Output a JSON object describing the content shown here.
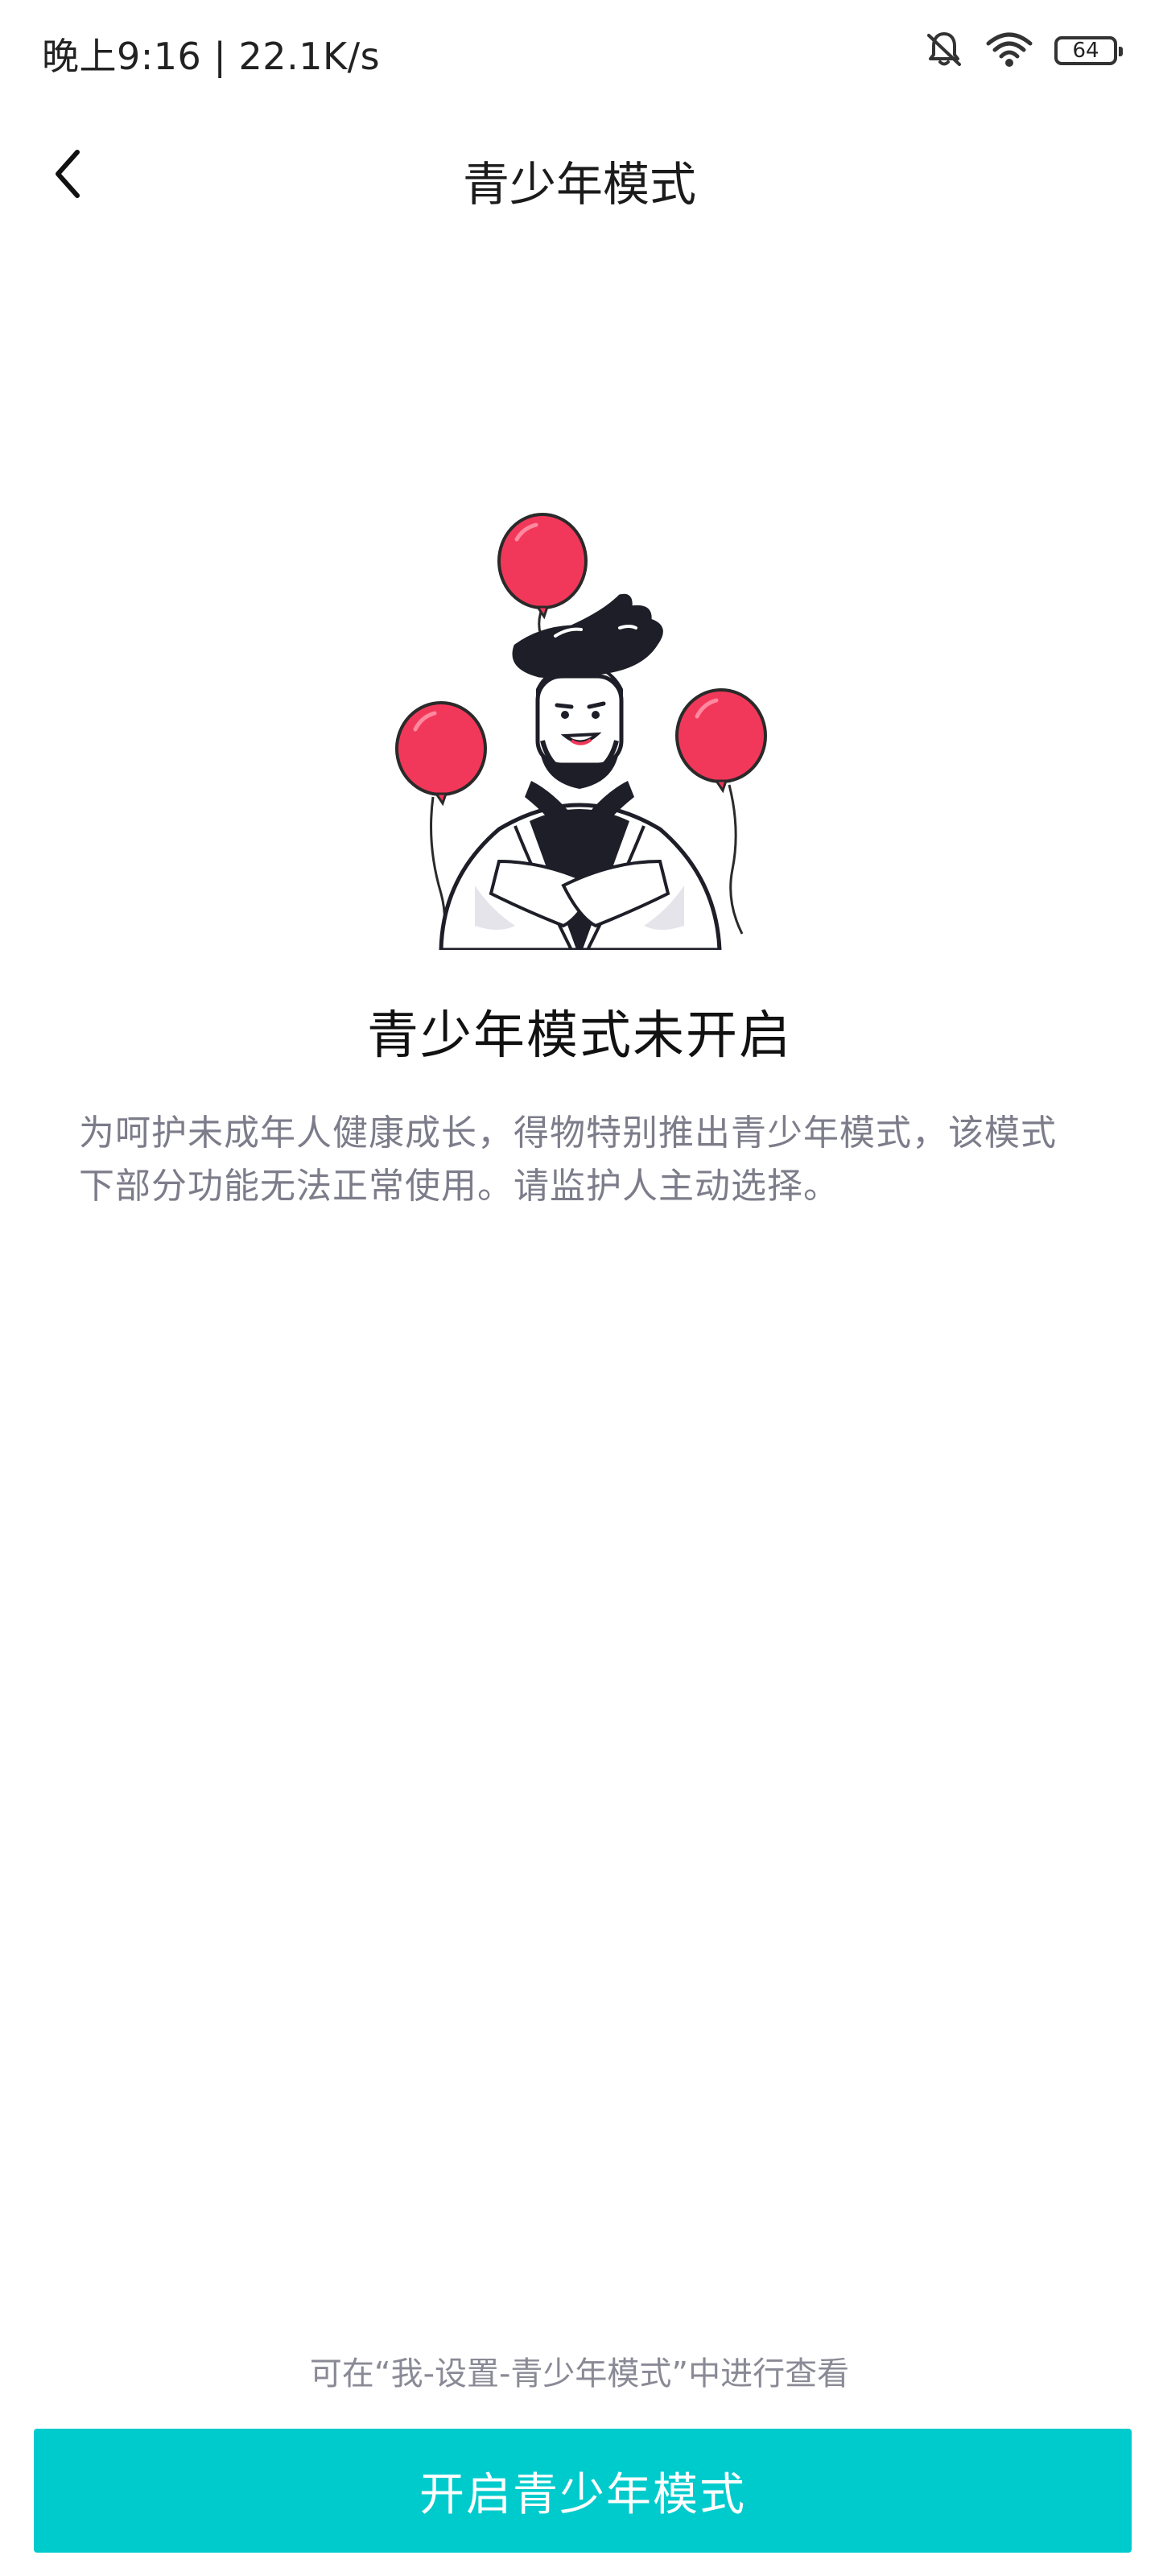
{
  "status_bar": {
    "time_and_speed": "晚上9:16 | 22.1K/s",
    "battery_level": "64",
    "icons": [
      "bell-muted-icon",
      "wifi-icon",
      "battery-icon"
    ]
  },
  "header": {
    "title": "青少年模式",
    "back_icon": "chevron-left-icon"
  },
  "main": {
    "illustration": "character-with-balloons",
    "heading": "青少年模式未开启",
    "description": "为呵护未成年人健康成长，得物特别推出青少年模式，该模式下部分功能无法正常使用。请监护人主动选择。"
  },
  "footer": {
    "hint": "可在“我-设置-青少年模式”中进行查看",
    "button_label": "开启青少年模式"
  },
  "colors": {
    "accent": "#00cbcc",
    "balloon": "#f2385a",
    "description_text": "#7c7c8a"
  }
}
